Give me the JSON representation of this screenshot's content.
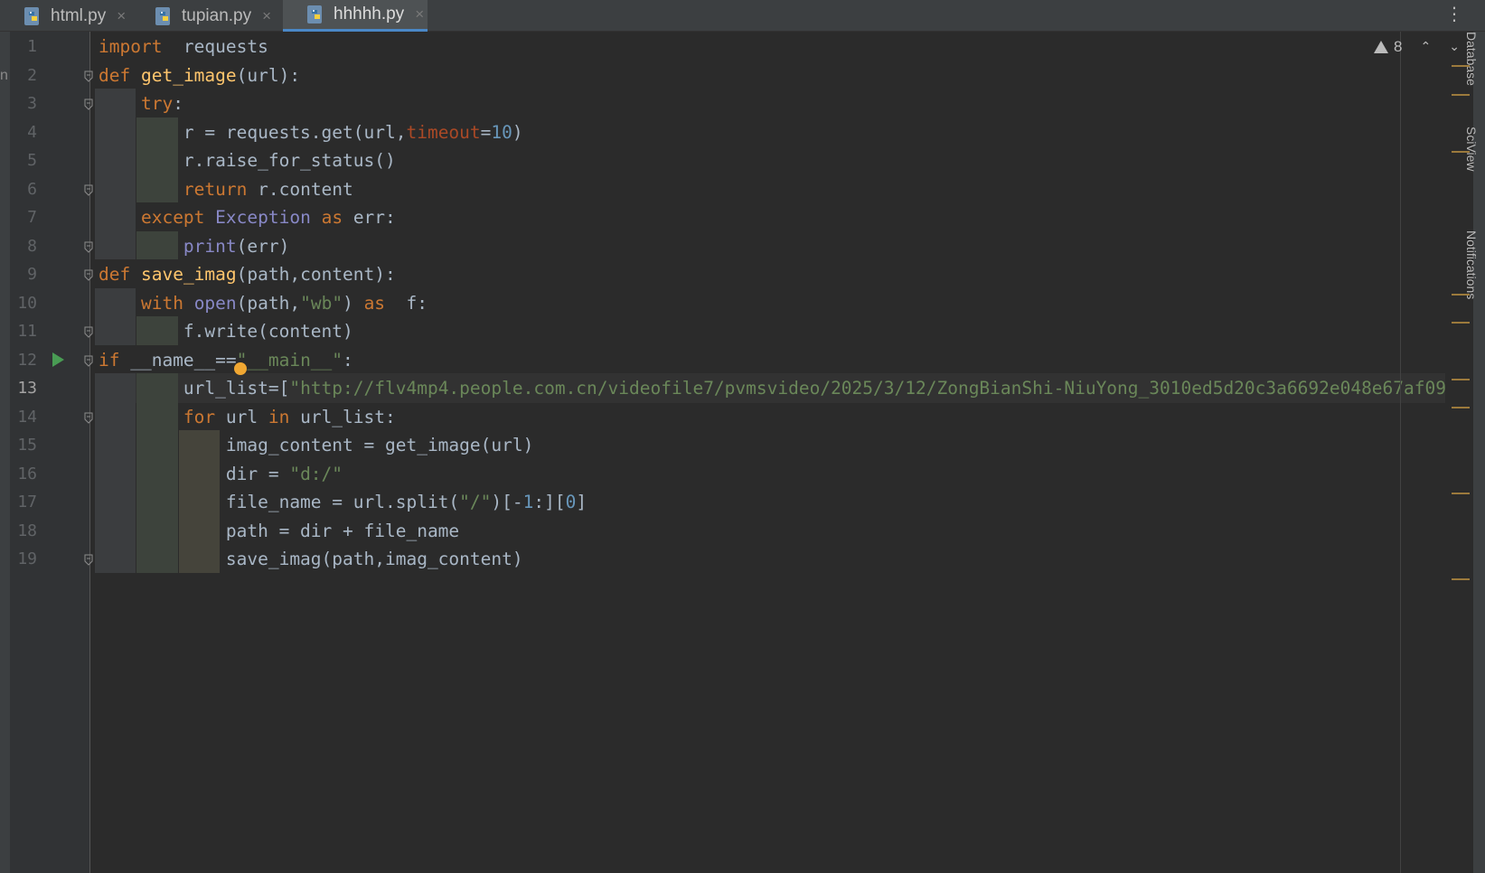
{
  "tabs": [
    {
      "label": "html.py",
      "active": false,
      "icon": "python-file-icon"
    },
    {
      "label": "tupian.py",
      "active": false,
      "icon": "python-file-icon"
    },
    {
      "label": "hhhhh.py",
      "active": true,
      "icon": "python-file-icon"
    }
  ],
  "tab_close_glyph": "×",
  "tab_menu_glyph": "⋮",
  "left_strip_letter": "n",
  "right_sidebar": {
    "items": [
      "Database",
      "SciView",
      "Notifications"
    ]
  },
  "inspection": {
    "warning_count": "8",
    "up_glyph": "⌃",
    "down_glyph": "⌄"
  },
  "editor": {
    "current_line": 13,
    "line_numbers": [
      "1",
      "2",
      "3",
      "4",
      "5",
      "6",
      "7",
      "8",
      "9",
      "10",
      "11",
      "12",
      "13",
      "14",
      "15",
      "16",
      "17",
      "18",
      "19"
    ],
    "code_lines": [
      "import  requests",
      "def get_image(url):",
      "    try:",
      "        r = requests.get(url,timeout=10)",
      "        r.raise_for_status()",
      "        return r.content",
      "    except Exception as err:",
      "        print(err)",
      "def save_imag(path,content):",
      "    with open(path,\"wb\") as  f:",
      "        f.write(content)",
      "if __name__==\"__main__\":",
      "        url_list=[\"http://flv4mp4.people.com.cn/videofile7/pvmsvideo/2025/3/12/ZongBianShi-NiuYong_3010ed5d20c3a6692e048e67af09",
      "        for url in url_list:",
      "            imag_content = get_image(url)",
      "            dir = \"d:/\"",
      "            file_name = url.split(\"/\")[-1:][0]",
      "            path = dir + file_name",
      "            save_imag(path,imag_content)"
    ]
  },
  "colors": {
    "keyword": "#cc7832",
    "function": "#ffc66d",
    "string": "#6a8759",
    "number": "#6897bb",
    "builtin": "#8888c6",
    "param": "#aa4926",
    "text": "#a9b7c6",
    "background": "#2b2b2b",
    "tab_accent": "#4a88c7"
  }
}
